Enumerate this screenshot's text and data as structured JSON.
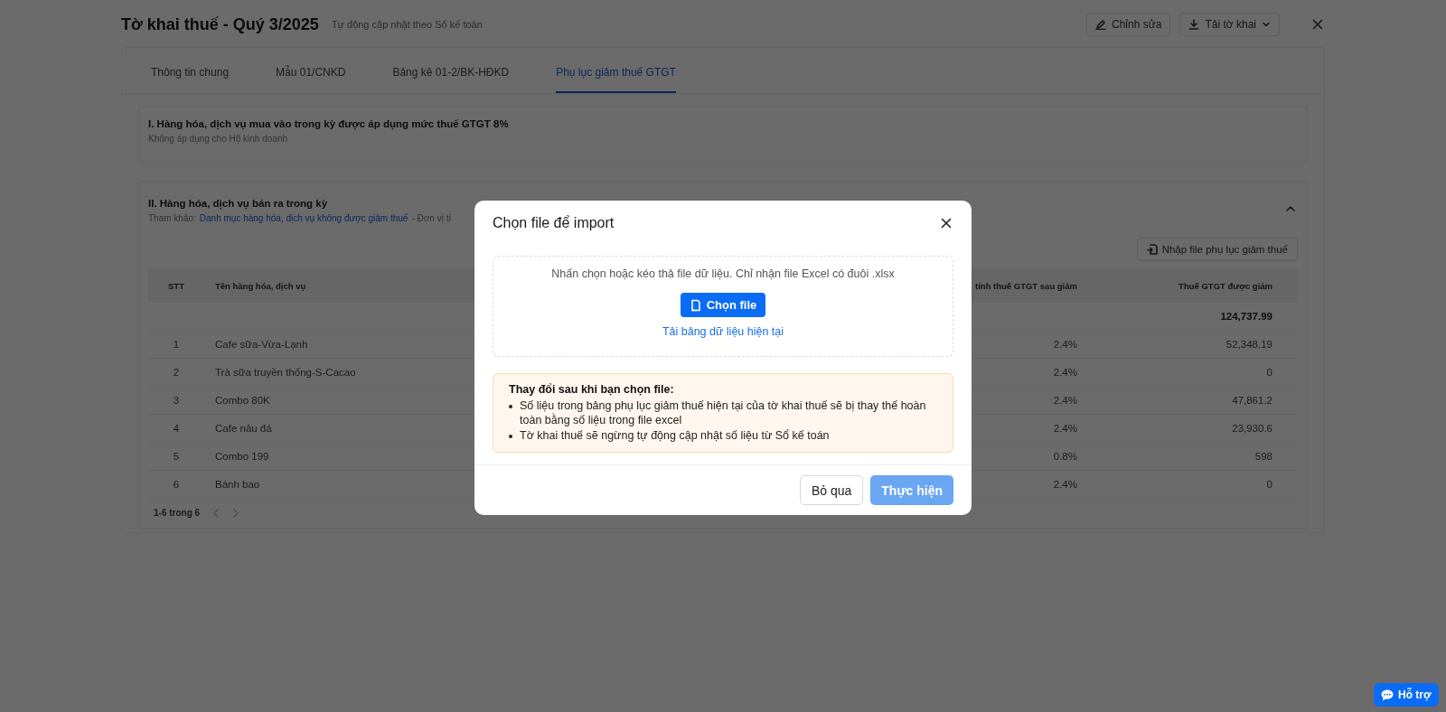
{
  "header": {
    "title": "Tờ khai thuế - Quý 3/2025",
    "subtitle": "Tự động cập nhật theo Sổ kế toán",
    "buttons": [
      {
        "kind": "edit",
        "label": "Chỉnh sửa"
      },
      {
        "kind": "download",
        "label": "Tải tờ khai"
      }
    ]
  },
  "tabs": [
    {
      "label": "Thông tin chung",
      "selected": false
    },
    {
      "label": "Mẫu 01/CNKD",
      "selected": false
    },
    {
      "label": "Bảng kê 01-2/BK-HĐKD",
      "selected": false
    },
    {
      "label": "Phụ lục giảm thuế GTGT",
      "selected": true
    }
  ],
  "section_1": {
    "title": "I. Hàng hóa, dịch vụ mua vào trong kỳ được áp dụng mức thuế GTGT 8%",
    "note": "Không áp dụng cho Hộ kinh doanh"
  },
  "section_2": {
    "title": "II. Hàng hóa, dịch vụ bán ra trong kỳ",
    "expanded": true,
    "ref_label": "Tham khảo:",
    "ref_link": "Danh mục hàng hóa, dịch vụ không được giảm thuế",
    "ref_tail": "- Đơn vị tí",
    "import_button": "Nhập file phụ lục giảm thuế",
    "table": {
      "columns": [
        "STT",
        "Tên hàng hóa, dịch vụ",
        "tính thuế GTGT sau giảm",
        "Thuế GTGT được giảm"
      ],
      "total": "124,737.99",
      "rows": [
        [
          "1",
          "Cafe sữa-Vừa-Lạnh",
          "2.4%",
          "52,348.19"
        ],
        [
          "2",
          "Trà sữa truyền thống-S-Cacao",
          "2.4%",
          "0"
        ],
        [
          "3",
          "Combo 80K",
          "2.4%",
          "47,861.2"
        ],
        [
          "4",
          "Cafe nâu đá",
          "2.4%",
          "23,930.6"
        ],
        [
          "5",
          "Combo 199",
          "0.8%",
          "598"
        ],
        [
          "6",
          "Bánh bao",
          "2.4%",
          "0"
        ]
      ]
    },
    "pagination": "1-6 trong 6"
  },
  "modal": {
    "title": "Chọn file để import",
    "drop_hint": "Nhấn chọn hoặc kéo thả file dữ liệu. Chỉ nhận file Excel có đuôi .xlsx",
    "choose_button": "Chọn file",
    "download_link": "Tải bảng dữ liệu hiện tại",
    "warning": {
      "title": "Thay đổi sau khi bạn chọn file:",
      "items": [
        "Số liệu trong bảng phụ lục giảm thuế hiện tại của tờ khai thuế sẽ bị thay thế hoàn toàn bằng số liệu trong file excel",
        "Tờ khai thuế sẽ ngừng tự động cập nhật số liệu từ Sổ kế toán"
      ]
    },
    "buttons": [
      {
        "label": "Bỏ qua",
        "kind": "secondary",
        "disabled": false
      },
      {
        "label": "Thực hiện",
        "kind": "primary",
        "disabled": true
      }
    ]
  },
  "help_button": "Hỗ trợ"
}
